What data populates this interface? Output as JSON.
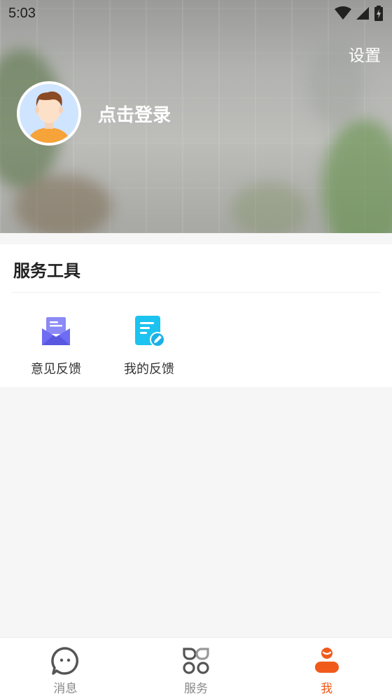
{
  "status_bar": {
    "time": "5:03",
    "icons": [
      "wifi-icon",
      "signal-icon",
      "battery-icon"
    ]
  },
  "profile": {
    "settings_label": "设置",
    "login_label": "点击登录",
    "avatar_icon": "default-avatar"
  },
  "service_tools": {
    "title": "服务工具",
    "items": [
      {
        "label": "意见反馈",
        "icon": "feedback-mail-icon",
        "color": "#6e6cf2"
      },
      {
        "label": "我的反馈",
        "icon": "my-feedback-doc-icon",
        "color": "#1cc3f0"
      }
    ]
  },
  "bottom_nav": {
    "items": [
      {
        "label": "消息",
        "icon": "message-icon",
        "active": false
      },
      {
        "label": "服务",
        "icon": "services-icon",
        "active": false
      },
      {
        "label": "我",
        "icon": "me-icon",
        "active": true
      }
    ],
    "active_color": "#f05a1a",
    "inactive_color": "#888888"
  }
}
